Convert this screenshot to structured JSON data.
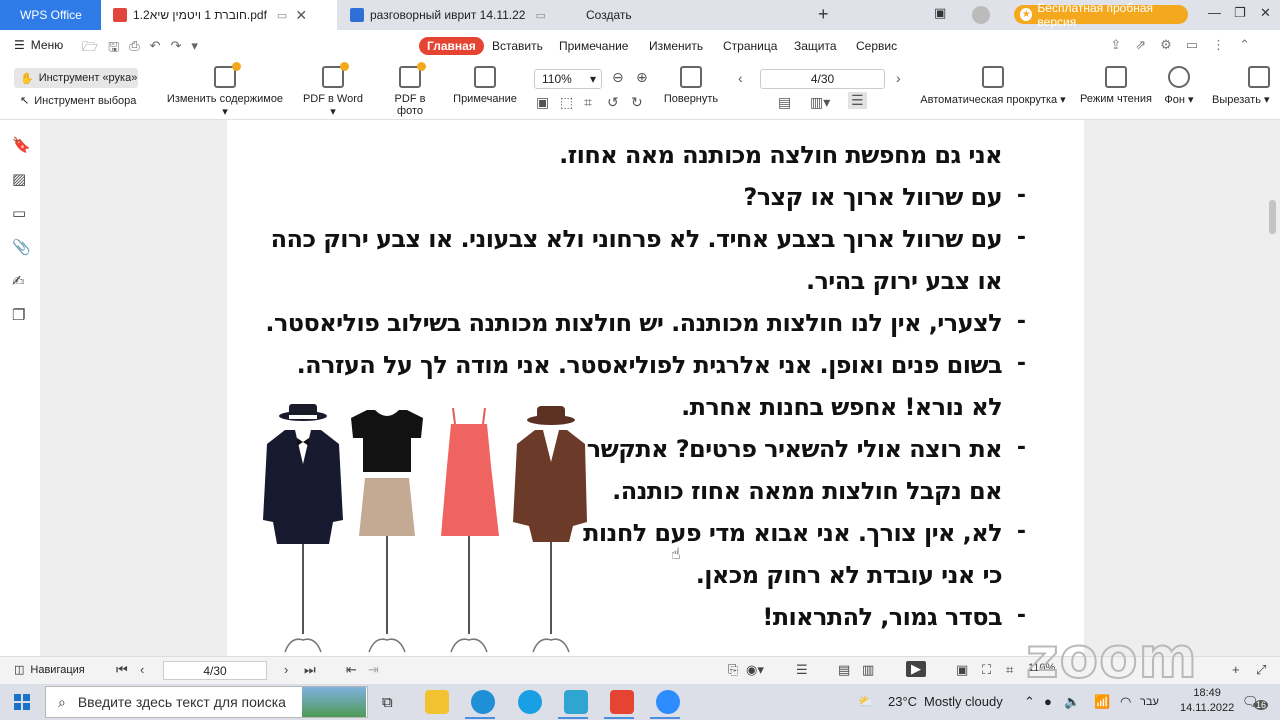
{
  "tabbar": {
    "app_name": "WPS Office",
    "tabs": [
      {
        "label": "חוברת 1 ויטמין שיא1.2.pdf",
        "active": true
      },
      {
        "label": "разговорный иврит 14.11.22",
        "active": false
      },
      {
        "label": "Создать",
        "active": false
      }
    ],
    "trial_label": "Бесплатная пробная версия"
  },
  "menu": {
    "menu_label": "Меню",
    "tabs": [
      "Главная",
      "Вставить",
      "Примечание",
      "Изменить",
      "Страница",
      "Защита",
      "Сервис"
    ],
    "active_tab": "Главная"
  },
  "toolbar": {
    "hand_tool": "Инструмент «рука»",
    "select_tool": "Инструмент выбора",
    "edit_content": "Изменить содержимое",
    "pdf_to_word": "PDF в Word",
    "pdf_to_image": "PDF в фото",
    "annotation": "Примечание",
    "zoom": "110%",
    "rotate": "Повернуть",
    "page_indicator": "4/30",
    "auto_scroll": "Автоматическая прокрутка",
    "reading_mode": "Режим чтения",
    "background": "Фон",
    "cut": "Вырезать"
  },
  "document": {
    "lines": [
      "אני גם מחפשת חולצה מכותנה מאה אחוז.",
      "עם שרוול ארוך או קצר?",
      "עם שרוול ארוך בצבע אחיד. לא פרחוני ולא צבעוני. או צבע ירוק כהה",
      "או צבע ירוק בהיר.",
      "לצערי, אין לנו חולצות מכותנה. יש חולצות מכותנה בשילוב פוליאסטר.",
      "בשום פנים ואופן. אני אלרגית לפוליאסטר. אני מודה לך על העזרה.",
      "לא נורא! אחפש בחנות אחרת.",
      "את רוצה אולי להשאיר פרטים? אתקשר",
      "אם נקבל חולצות ממאה אחוז כותנה.",
      "לא, אין צורך. אני אבוא מדי פעם לחנות",
      "כי אני עובדת לא רחוק מכאן.",
      "בסדר גמור, להתראות!"
    ],
    "dash": "-"
  },
  "status": {
    "navigation": "Навигация",
    "page": "4/30",
    "zoom": "110%"
  },
  "watermark": "zoom",
  "taskbar": {
    "search_placeholder": "Введите здесь текст для поиска",
    "weather_temp": "23°C",
    "weather_text": "Mostly cloudy",
    "language": "עבר",
    "time": "18:49",
    "date": "14.11.2022",
    "notifications": "16"
  },
  "colors": {
    "wps_blue": "#2f7be8",
    "active_menu_red": "#e64433",
    "trial_orange": "#f4a81d"
  }
}
